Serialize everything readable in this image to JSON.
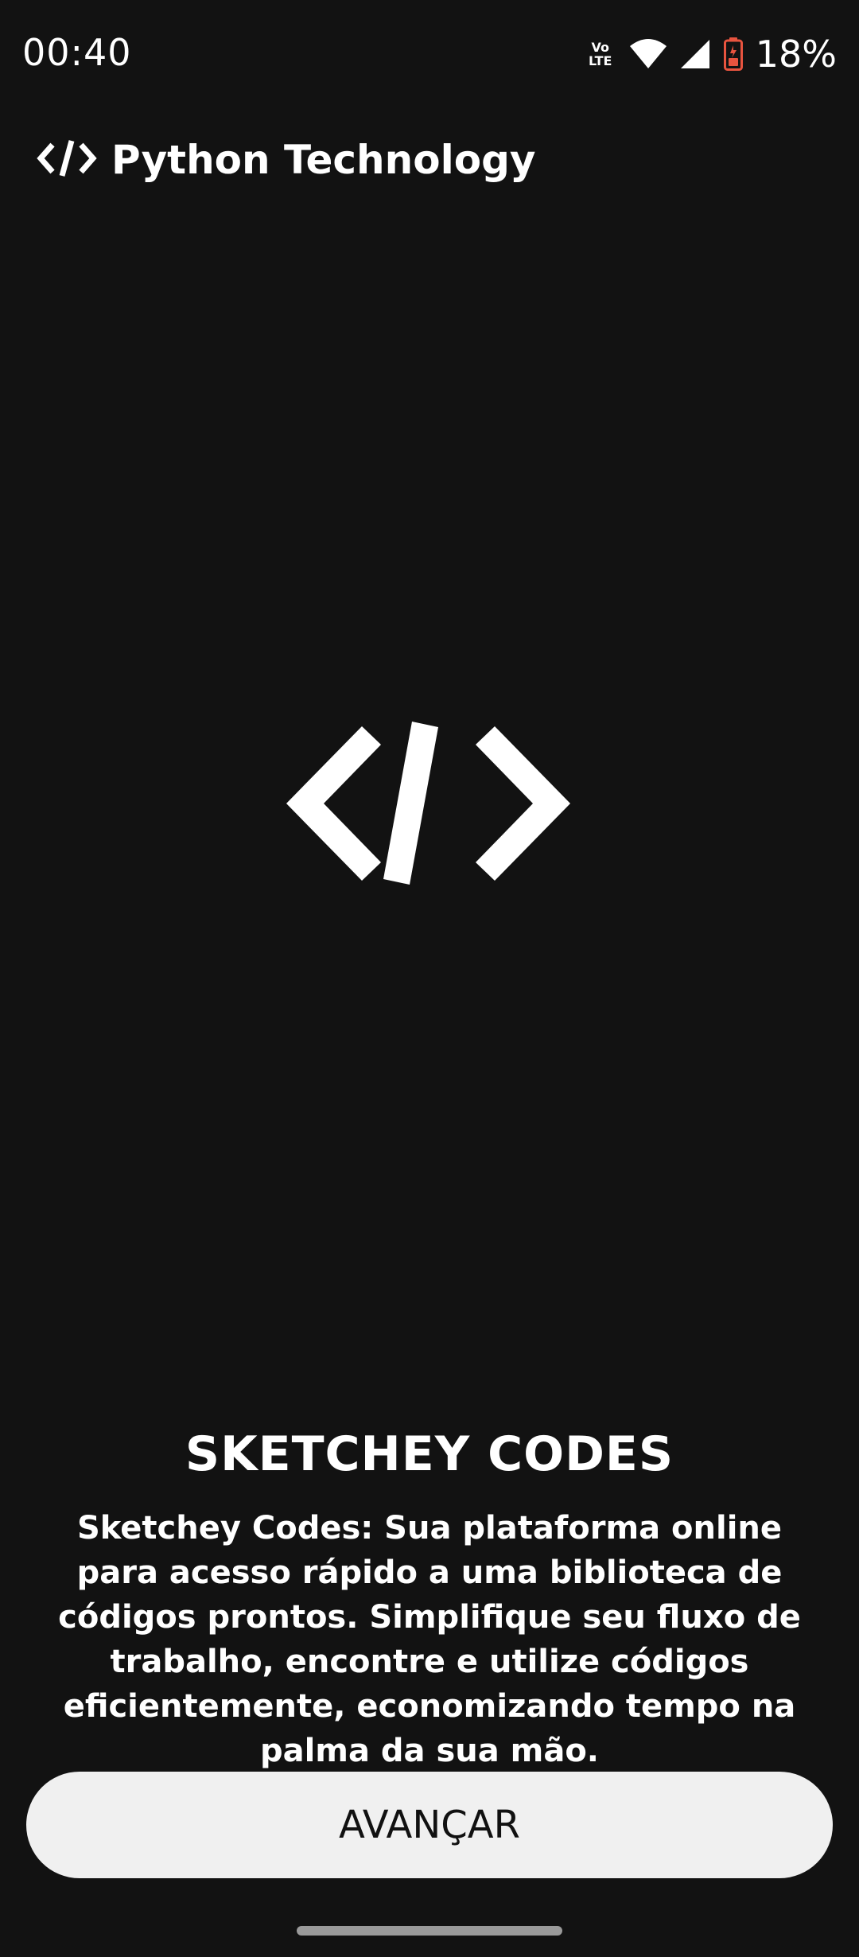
{
  "status_bar": {
    "time": "00:40",
    "volte_top": "Vo",
    "volte_bottom": "LTE",
    "battery_percent": "18%",
    "icons": [
      "volte-icon",
      "wifi-icon",
      "cellular-signal-icon",
      "battery-low-icon"
    ],
    "battery_color": "#e8543f"
  },
  "app_bar": {
    "icon": "code-icon",
    "title": "Python Technology"
  },
  "hero": {
    "icon": "code-icon"
  },
  "content": {
    "headline": "SKETCHEY CODES",
    "description": "Sketchey Codes: Sua plataforma online para acesso rápido a uma biblioteca de códigos prontos. Simplifique seu fluxo de trabalho, encontre e utilize códigos eficientemente, economizando tempo na palma da sua mão."
  },
  "actions": {
    "advance_label": "AVANÇAR"
  },
  "colors": {
    "background": "#121212",
    "button_background": "#f0f0f0",
    "button_text": "#111111",
    "text": "#ffffff"
  }
}
